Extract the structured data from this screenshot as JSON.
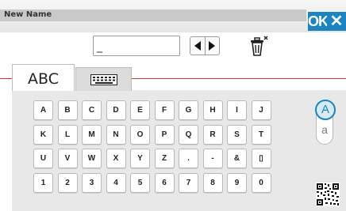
{
  "header": {
    "title": "New Name",
    "ok_label": "OK",
    "close_label": "✕"
  },
  "name_input": {
    "value": "_"
  },
  "tabs": [
    {
      "label": "ABC",
      "active": true
    },
    {
      "label": "",
      "icon": "keyboard-icon",
      "active": false
    }
  ],
  "keys": [
    [
      "A",
      "B",
      "C",
      "D",
      "E",
      "F",
      "G",
      "H",
      "I",
      "J"
    ],
    [
      "K",
      "L",
      "M",
      "N",
      "O",
      "P",
      "Q",
      "R",
      "S",
      "T"
    ],
    [
      "U",
      "V",
      "W",
      "X",
      "Y",
      "Z",
      ".",
      "-",
      "&",
      "▯"
    ],
    [
      "1",
      "2",
      "3",
      "4",
      "5",
      "6",
      "7",
      "8",
      "9",
      "0"
    ]
  ],
  "case_toggle": {
    "upper": "A",
    "lower": "a",
    "selected": "upper"
  },
  "icons": {
    "cursor_left": "triangle-left-icon",
    "cursor_right": "triangle-right-icon",
    "delete": "trash-icon",
    "keyboard": "keyboard-icon",
    "barcode": "qr-code-icon"
  },
  "colors": {
    "accent": "#1d84c4",
    "divider": "#d9322e",
    "panel": "#e8e8e8"
  }
}
